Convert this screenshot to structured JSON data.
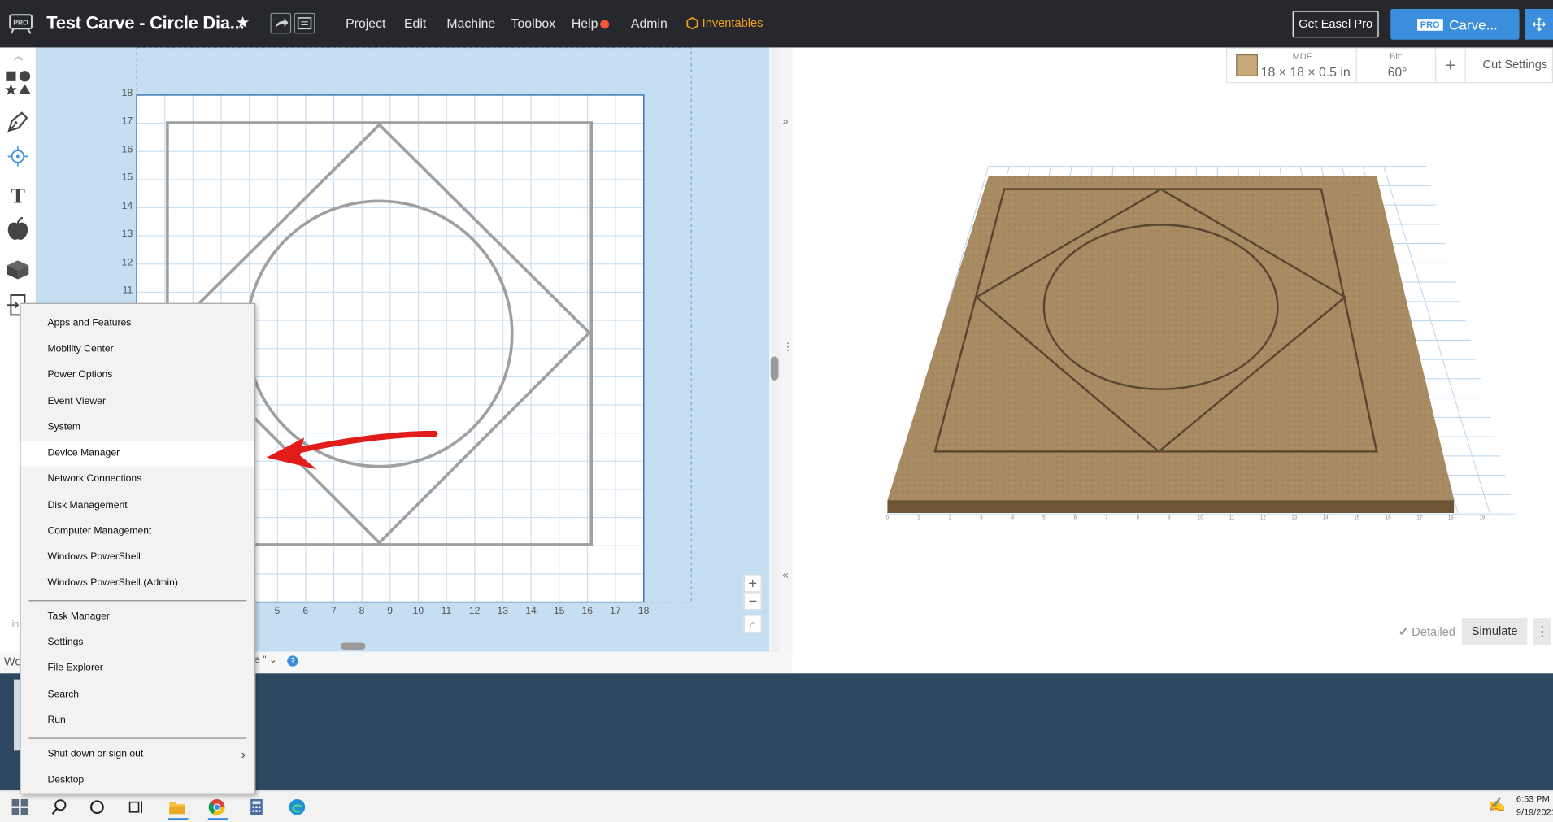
{
  "app": {
    "title": "Test Carve - Circle Dia...",
    "menu": [
      "Project",
      "Edit",
      "Machine",
      "Toolbox",
      "Help",
      "Admin"
    ],
    "inventables": "Inventables",
    "get_pro": "Get Easel Pro",
    "pro_badge": "PRO",
    "carve_button": "Carve...",
    "colors": {
      "topbar": "#26282e",
      "accent": "#3b8edb",
      "inventables": "#f2a21c",
      "help_dot": "#f05a3a"
    }
  },
  "design": {
    "y_ticks": [
      "18",
      "17",
      "16",
      "15",
      "14",
      "13",
      "12",
      "11"
    ],
    "x_ticks": [
      "5",
      "6",
      "7",
      "8",
      "9",
      "10",
      "11",
      "12",
      "13",
      "14",
      "15",
      "16",
      "17",
      "18"
    ],
    "zoom_in": "+",
    "zoom_out": "−",
    "units": "in"
  },
  "preview": {
    "material_label": "MDF",
    "material_size": "18 × 18 × 0.5 in",
    "bit_label": "Bit:",
    "bit_value": "60°",
    "add": "+",
    "cut_settings": "Cut Settings",
    "detailed": "✔ Detailed",
    "simulate": "Simulate",
    "more": "⋮",
    "x_ticks": [
      "0",
      "1",
      "2",
      "3",
      "4",
      "5",
      "6",
      "7",
      "8",
      "9",
      "10",
      "11",
      "12",
      "13",
      "14",
      "15",
      "16",
      "17",
      "18",
      "19"
    ]
  },
  "status": {
    "left": "Wo",
    "mid": "e \" ⌄"
  },
  "context_menu": {
    "items": [
      "Apps and Features",
      "Mobility Center",
      "Power Options",
      "Event Viewer",
      "System",
      "Device Manager",
      "Network Connections",
      "Disk Management",
      "Computer Management",
      "Windows PowerShell",
      "Windows PowerShell (Admin)",
      "Task Manager",
      "Settings",
      "File Explorer",
      "Search",
      "Run",
      "Shut down or sign out",
      "Desktop"
    ],
    "highlighted": "Device Manager"
  },
  "taskbar": {
    "time": "6:53 PM",
    "date": "9/19/2021"
  }
}
